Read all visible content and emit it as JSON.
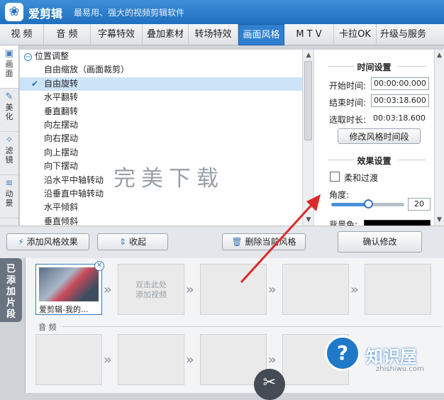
{
  "app": {
    "name": "爱剪辑",
    "slogan": "最易用、强大的视频剪辑软件",
    "logo_icon": "film-reel-icon"
  },
  "tabs": [
    {
      "label": "视 频"
    },
    {
      "label": "音 频"
    },
    {
      "label": "字幕特效"
    },
    {
      "label": "叠加素材"
    },
    {
      "label": "转场特效"
    },
    {
      "label": "画面风格",
      "active": true
    },
    {
      "label": "M T V"
    },
    {
      "label": "卡拉OK"
    },
    {
      "label": "升级与服务"
    }
  ],
  "side_tabs": [
    {
      "label": "画面",
      "icon": "screen-icon",
      "active": true
    },
    {
      "label": "美化",
      "icon": "magic-wand-icon"
    },
    {
      "label": "滤镜",
      "icon": "sparkle-wand-icon"
    },
    {
      "label": "动景",
      "icon": "wave-icon"
    }
  ],
  "effects_list": {
    "group": "位置调整",
    "items": [
      "自由缩放（画面裁剪）",
      "自由旋转",
      "水平翻转",
      "垂直翻转",
      "向左摆动",
      "向右摆动",
      "向上摆动",
      "向下摆动",
      "沿水平中轴转动",
      "沿垂直中轴转动",
      "水平倾斜",
      "垂直倾斜"
    ],
    "selected_index": 1
  },
  "time_settings": {
    "title": "时间设置",
    "start_label": "开始时间:",
    "start_value": "00:00:00.000",
    "end_label": "结束时间:",
    "end_value": "00:03:18.600",
    "duration_label": "选取时长:",
    "duration_value": "00:03:18.600",
    "modify_button": "修改风格时间段"
  },
  "effect_settings": {
    "title": "效果设置",
    "soft_transition_label": "柔和过渡",
    "soft_transition_checked": false,
    "angle_label": "角度:",
    "angle_value": "20",
    "angle_slider_fraction": 0.52,
    "bg_color_label": "背景色:",
    "bg_color": "#000000"
  },
  "toolbar": {
    "add_effect": "添加风格效果",
    "add_icon": "wand-plus-icon",
    "collapse": "收起",
    "collapse_icon": "collapse-arrows-icon",
    "delete_effect": "删除当前风格",
    "delete_icon": "trash-icon",
    "confirm": "确认修改"
  },
  "timeline": {
    "side_label": "已添加片段",
    "clip_caption": "爱剪辑-我的...",
    "placeholder": "双击此处\n添加视频",
    "audio_label": "音 频"
  },
  "watermarks": {
    "center": "完美下载",
    "brand": "知识屋",
    "brand_url": "zhishiwu.com"
  }
}
